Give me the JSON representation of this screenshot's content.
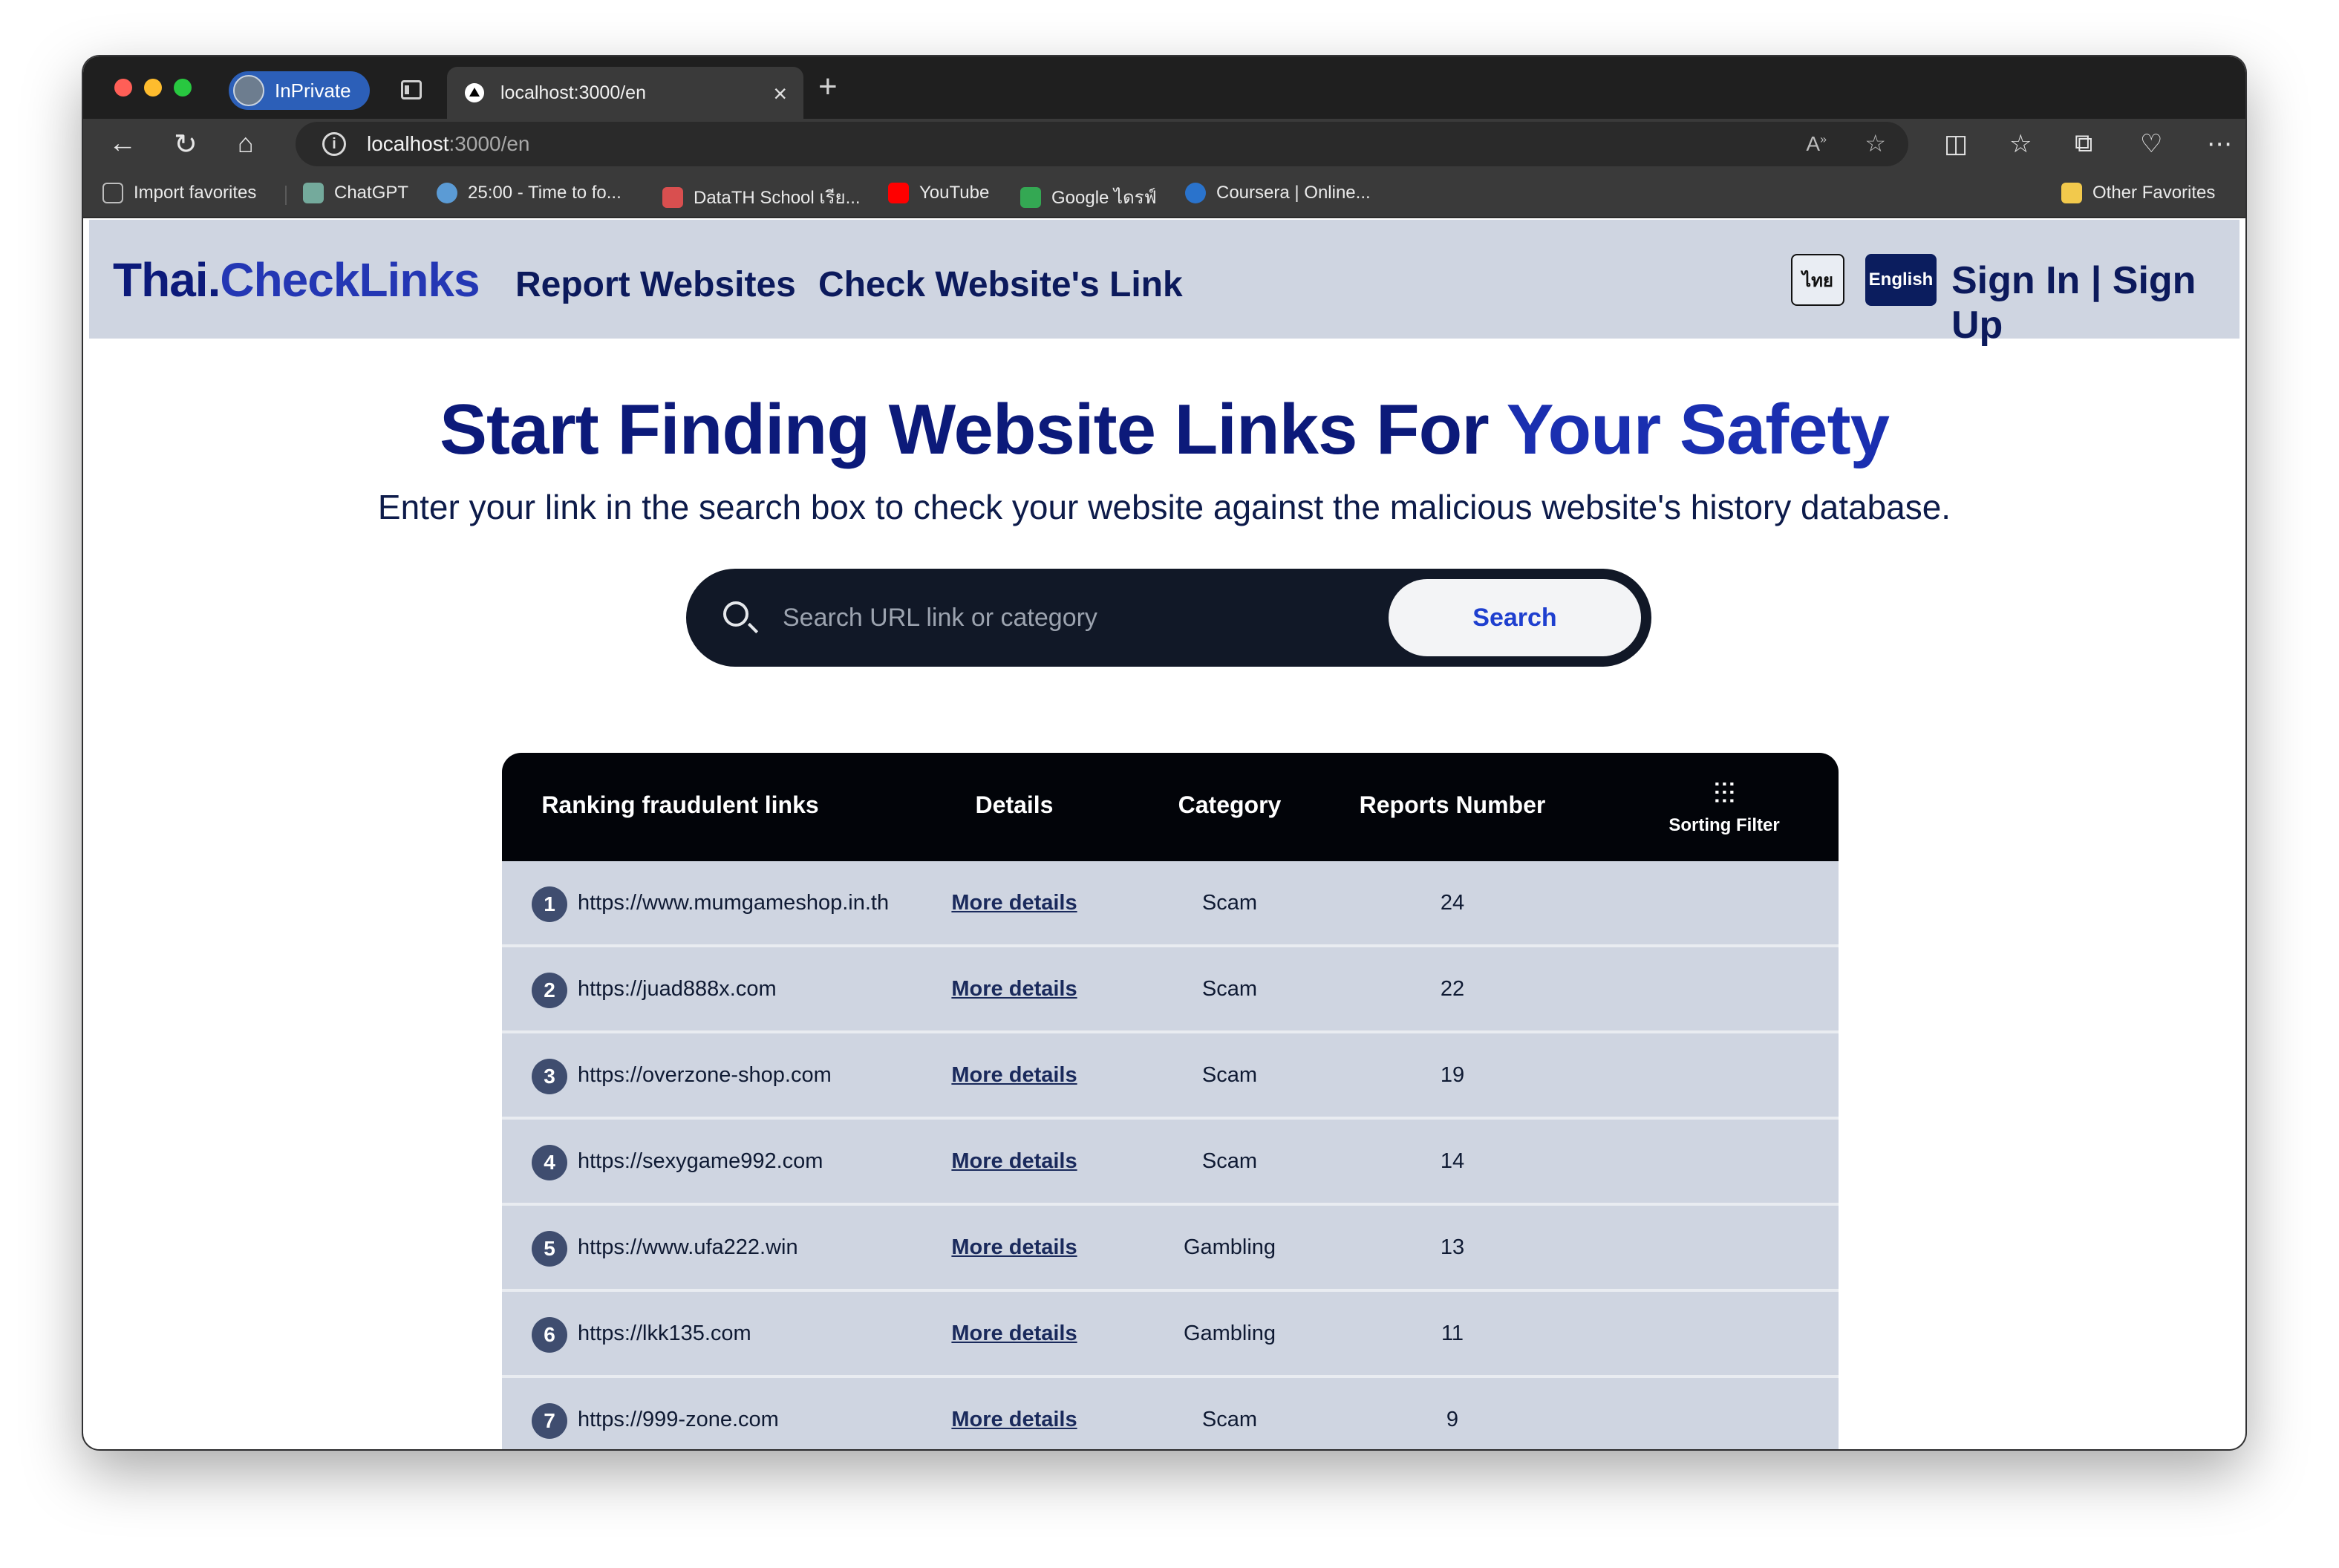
{
  "browser": {
    "profile_label": "InPrivate",
    "tab_title": "localhost:3000/en",
    "url_host": "localhost",
    "url_path": ":3000/en",
    "bookmarks": [
      {
        "label": "Import favorites",
        "color": "#9aa0a6"
      },
      {
        "label": "ChatGPT",
        "color": "#74aa9c"
      },
      {
        "label": "25:00 - Time to fo...",
        "color": "#5b9bd5"
      },
      {
        "label": "DataTH School เรีย...",
        "color": "#d94f4f"
      },
      {
        "label": "YouTube",
        "color": "#ff0000"
      },
      {
        "label": "Google ไดรฟ์",
        "color": "#34a853"
      },
      {
        "label": "Coursera | Online...",
        "color": "#2a73cc"
      }
    ],
    "other_favorites": "Other Favorites"
  },
  "site": {
    "logo_part1": "Thai.",
    "logo_part2": "CheckLinks",
    "nav": [
      "Report Websites",
      "Check Website's Link"
    ],
    "lang_th": "ไทย",
    "lang_en": "English",
    "auth": "Sign In | Sign Up"
  },
  "hero": {
    "title_a": "Start Finding ",
    "title_b": "Website Links",
    "title_c": " For ",
    "title_d": "Your Safety",
    "subtitle": "Enter your link in the search box to check your website against the malicious website's history database."
  },
  "search": {
    "placeholder": "Search URL link or category",
    "button": "Search"
  },
  "table": {
    "headers": [
      "Ranking fraudulent links",
      "Details",
      "Category",
      "Reports Number"
    ],
    "filter_label": "Sorting Filter",
    "rows": [
      {
        "rank": "1",
        "url": "https://www.mumgameshop.in.th",
        "details": "More details",
        "category": "Scam",
        "reports": "24"
      },
      {
        "rank": "2",
        "url": "https://juad888x.com",
        "details": "More details",
        "category": "Scam",
        "reports": "22"
      },
      {
        "rank": "3",
        "url": "https://overzone-shop.com",
        "details": "More details",
        "category": "Scam",
        "reports": "19"
      },
      {
        "rank": "4",
        "url": "https://sexygame992.com",
        "details": "More details",
        "category": "Scam",
        "reports": "14"
      },
      {
        "rank": "5",
        "url": "https://www.ufa222.win",
        "details": "More details",
        "category": "Gambling",
        "reports": "13"
      },
      {
        "rank": "6",
        "url": "https://lkk135.com",
        "details": "More details",
        "category": "Gambling",
        "reports": "11"
      },
      {
        "rank": "7",
        "url": "https://999-zone.com",
        "details": "More details",
        "category": "Scam",
        "reports": "9"
      }
    ]
  }
}
